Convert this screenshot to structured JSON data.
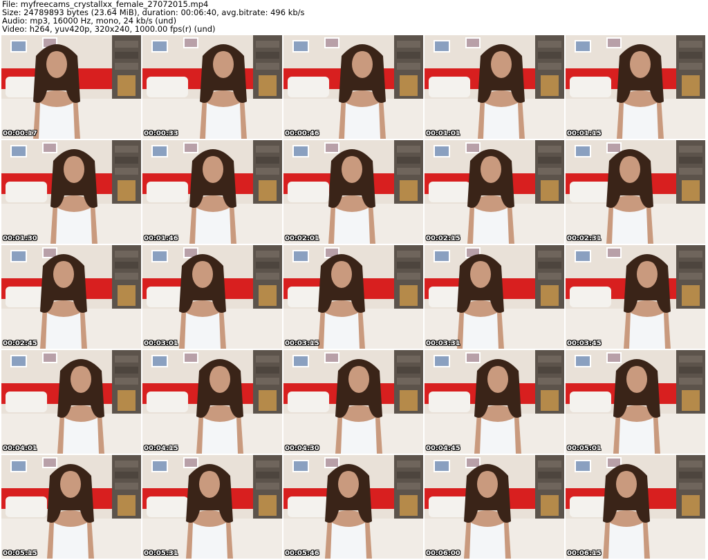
{
  "header": {
    "file_line": "File: myfreecams_crystallxx_female_27072015.mp4",
    "size_line": "Size: 24789893 bytes (23.64 MiB), duration: 00:06:40, avg.bitrate: 496 kb/s",
    "audio_line": "Audio: mp3, 16000 Hz, mono, 24 kb/s (und)",
    "video_line": "Video: h264, yuv420p, 320x240, 1000.00 fps(r) (und)"
  },
  "colors": {
    "wall": "#e9e1d8",
    "headboard": "#d81f1f",
    "pillow": "#f4f2ee",
    "bedsheet": "#f1ece6",
    "stone": "#5c534b",
    "hair": "#3a2418",
    "skin": "#c99a7e",
    "top": "#f4f6f8"
  },
  "thumbnails": [
    {
      "timestamp": "00:00:17"
    },
    {
      "timestamp": "00:00:33"
    },
    {
      "timestamp": "00:00:46"
    },
    {
      "timestamp": "00:01:01"
    },
    {
      "timestamp": "00:01:15"
    },
    {
      "timestamp": "00:01:30"
    },
    {
      "timestamp": "00:01:46"
    },
    {
      "timestamp": "00:02:01"
    },
    {
      "timestamp": "00:02:15"
    },
    {
      "timestamp": "00:02:31"
    },
    {
      "timestamp": "00:02:45"
    },
    {
      "timestamp": "00:03:01"
    },
    {
      "timestamp": "00:03:15"
    },
    {
      "timestamp": "00:03:31"
    },
    {
      "timestamp": "00:03:45"
    },
    {
      "timestamp": "00:04:01"
    },
    {
      "timestamp": "00:04:15"
    },
    {
      "timestamp": "00:04:30"
    },
    {
      "timestamp": "00:04:45"
    },
    {
      "timestamp": "00:05:01"
    },
    {
      "timestamp": "00:05:15"
    },
    {
      "timestamp": "00:05:31"
    },
    {
      "timestamp": "00:05:46"
    },
    {
      "timestamp": "00:06:00"
    },
    {
      "timestamp": "00:06:15"
    }
  ]
}
